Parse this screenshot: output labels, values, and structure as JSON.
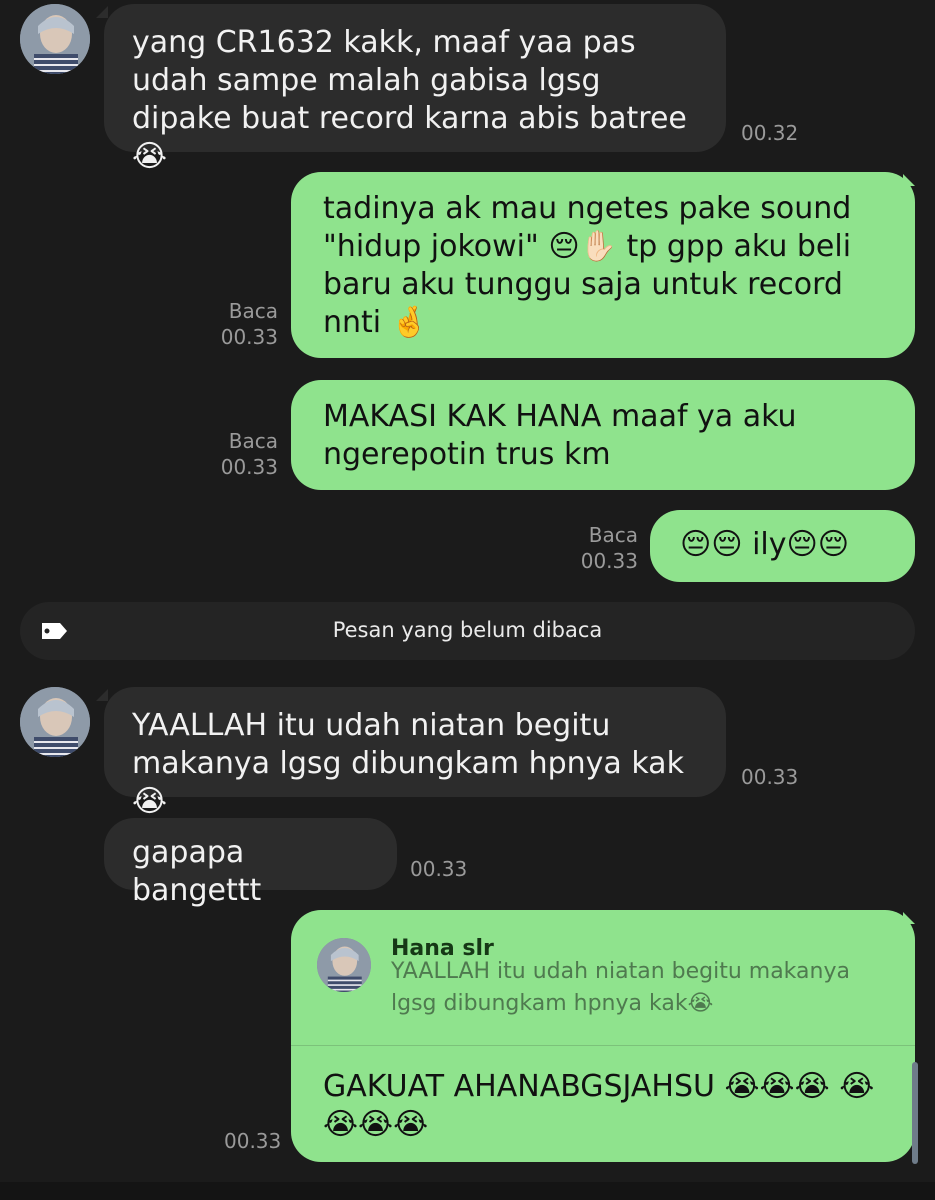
{
  "messages": [
    {
      "id": "m1",
      "side": "in",
      "text": "yang CR1632 kakk, maaf yaa pas udah sampe malah gabisa lgsg dipake buat record karna abis batree😭",
      "time": "00.32"
    },
    {
      "id": "m2",
      "side": "out",
      "text": "tadinya ak mau ngetes pake sound \"hidup jokowi\" 😔✋🏻 tp gpp aku beli baru aku tunggu saja untuk record nnti 🤞",
      "read": "Baca",
      "time": "00.33"
    },
    {
      "id": "m3",
      "side": "out",
      "text": "MAKASI KAK HANA maaf ya aku ngerepotin trus km",
      "read": "Baca",
      "time": "00.33"
    },
    {
      "id": "m4",
      "side": "out",
      "text": "😔😔 ily😔😔",
      "read": "Baca",
      "time": "00.33"
    },
    {
      "id": "m5",
      "side": "in",
      "text": "YAALLAH itu udah niatan begitu makanya lgsg dibungkam hpnya kak😭",
      "time": "00.33"
    },
    {
      "id": "m6",
      "side": "in",
      "text": "gapapa bangettt",
      "time": "00.33"
    },
    {
      "id": "m7",
      "side": "out",
      "reply": {
        "name": "Hana slr",
        "text": "YAALLAH itu udah niatan begitu makanya lgsg dibungkam hpnya kak😭"
      },
      "text": "GAKUAT AHANABGSJAHSU 😭😭😭 😭😭😭😭",
      "time": "00.33"
    }
  ],
  "divider": {
    "text": "Pesan yang belum dibaca",
    "icon": "label-tag-icon"
  },
  "colors": {
    "background": "#1b1b1b",
    "incoming": "#2c2c2c",
    "outgoing": "#8fe38d"
  }
}
